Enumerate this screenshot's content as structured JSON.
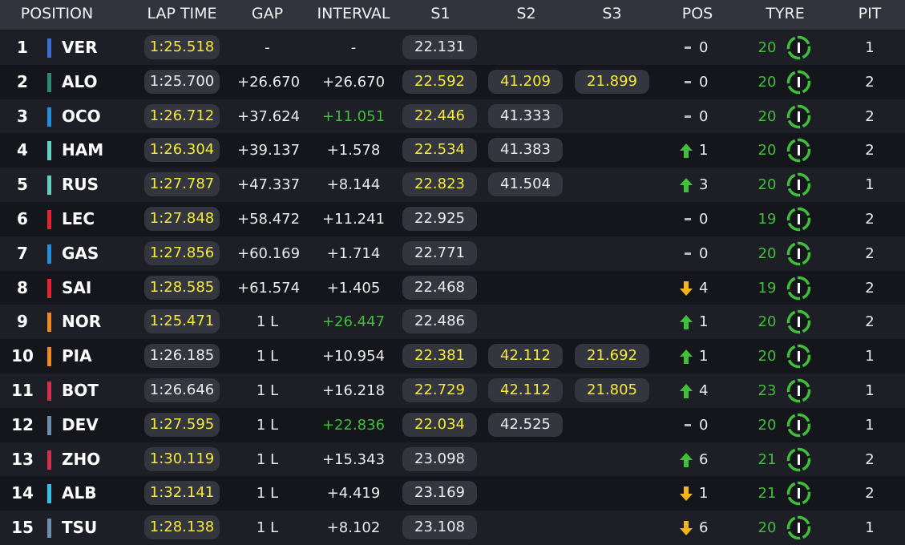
{
  "header": {
    "position": "POSITION",
    "lap_time": "LAP TIME",
    "gap": "GAP",
    "interval": "INTERVAL",
    "s1": "S1",
    "s2": "S2",
    "s3": "S3",
    "pos": "POS",
    "tyre": "TYRE",
    "pit": "PIT"
  },
  "rows": [
    {
      "pos": "1",
      "code": "VER",
      "team_color": "#3a6fd8",
      "lap": "1:25.518",
      "lap_best": true,
      "gap": "-",
      "interval": "-",
      "interval_green": false,
      "s1": "22.131",
      "s1_y": false,
      "s2": "",
      "s2_y": false,
      "s3": "",
      "s3_y": false,
      "change": "none",
      "change_val": "0",
      "laps": "20",
      "pit": "1"
    },
    {
      "pos": "2",
      "code": "ALO",
      "team_color": "#2c8b6f",
      "lap": "1:25.700",
      "lap_best": false,
      "gap": "+26.670",
      "interval": "+26.670",
      "interval_green": false,
      "s1": "22.592",
      "s1_y": true,
      "s2": "41.209",
      "s2_y": true,
      "s3": "21.899",
      "s3_y": true,
      "change": "none",
      "change_val": "0",
      "laps": "20",
      "pit": "2"
    },
    {
      "pos": "3",
      "code": "OCO",
      "team_color": "#1f8fe0",
      "lap": "1:26.712",
      "lap_best": true,
      "gap": "+37.624",
      "interval": "+11.051",
      "interval_green": true,
      "s1": "22.446",
      "s1_y": true,
      "s2": "41.333",
      "s2_y": false,
      "s3": "",
      "s3_y": false,
      "change": "none",
      "change_val": "0",
      "laps": "20",
      "pit": "2"
    },
    {
      "pos": "4",
      "code": "HAM",
      "team_color": "#5fd2c4",
      "lap": "1:26.304",
      "lap_best": true,
      "gap": "+39.137",
      "interval": "+1.578",
      "interval_green": false,
      "s1": "22.534",
      "s1_y": true,
      "s2": "41.383",
      "s2_y": false,
      "s3": "",
      "s3_y": false,
      "change": "up",
      "change_val": "1",
      "laps": "20",
      "pit": "2"
    },
    {
      "pos": "5",
      "code": "RUS",
      "team_color": "#5fd2c4",
      "lap": "1:27.787",
      "lap_best": true,
      "gap": "+47.337",
      "interval": "+8.144",
      "interval_green": false,
      "s1": "22.823",
      "s1_y": true,
      "s2": "41.504",
      "s2_y": false,
      "s3": "",
      "s3_y": false,
      "change": "up",
      "change_val": "3",
      "laps": "20",
      "pit": "1"
    },
    {
      "pos": "6",
      "code": "LEC",
      "team_color": "#e8232f",
      "lap": "1:27.848",
      "lap_best": true,
      "gap": "+58.472",
      "interval": "+11.241",
      "interval_green": false,
      "s1": "22.925",
      "s1_y": false,
      "s2": "",
      "s2_y": false,
      "s3": "",
      "s3_y": false,
      "change": "none",
      "change_val": "0",
      "laps": "19",
      "pit": "2"
    },
    {
      "pos": "7",
      "code": "GAS",
      "team_color": "#1f8fe0",
      "lap": "1:27.856",
      "lap_best": true,
      "gap": "+60.169",
      "interval": "+1.714",
      "interval_green": false,
      "s1": "22.771",
      "s1_y": false,
      "s2": "",
      "s2_y": false,
      "s3": "",
      "s3_y": false,
      "change": "none",
      "change_val": "0",
      "laps": "20",
      "pit": "2"
    },
    {
      "pos": "8",
      "code": "SAI",
      "team_color": "#e8232f",
      "lap": "1:28.585",
      "lap_best": true,
      "gap": "+61.574",
      "interval": "+1.405",
      "interval_green": false,
      "s1": "22.468",
      "s1_y": false,
      "s2": "",
      "s2_y": false,
      "s3": "",
      "s3_y": false,
      "change": "down",
      "change_val": "4",
      "laps": "19",
      "pit": "2"
    },
    {
      "pos": "9",
      "code": "NOR",
      "team_color": "#f08a1c",
      "lap": "1:25.471",
      "lap_best": true,
      "gap": "1 L",
      "interval": "+26.447",
      "interval_green": true,
      "s1": "22.486",
      "s1_y": false,
      "s2": "",
      "s2_y": false,
      "s3": "",
      "s3_y": false,
      "change": "up",
      "change_val": "1",
      "laps": "20",
      "pit": "2"
    },
    {
      "pos": "10",
      "code": "PIA",
      "team_color": "#f08a1c",
      "lap": "1:26.185",
      "lap_best": false,
      "gap": "1 L",
      "interval": "+10.954",
      "interval_green": false,
      "s1": "22.381",
      "s1_y": true,
      "s2": "42.112",
      "s2_y": true,
      "s3": "21.692",
      "s3_y": true,
      "change": "up",
      "change_val": "1",
      "laps": "20",
      "pit": "1"
    },
    {
      "pos": "11",
      "code": "BOT",
      "team_color": "#d62d4a",
      "lap": "1:26.646",
      "lap_best": false,
      "gap": "1 L",
      "interval": "+16.218",
      "interval_green": false,
      "s1": "22.729",
      "s1_y": true,
      "s2": "42.112",
      "s2_y": true,
      "s3": "21.805",
      "s3_y": true,
      "change": "up",
      "change_val": "4",
      "laps": "23",
      "pit": "1"
    },
    {
      "pos": "12",
      "code": "DEV",
      "team_color": "#6a8fb0",
      "lap": "1:27.595",
      "lap_best": true,
      "gap": "1 L",
      "interval": "+22.836",
      "interval_green": true,
      "s1": "22.034",
      "s1_y": true,
      "s2": "42.525",
      "s2_y": false,
      "s3": "",
      "s3_y": false,
      "change": "none",
      "change_val": "0",
      "laps": "20",
      "pit": "1"
    },
    {
      "pos": "13",
      "code": "ZHO",
      "team_color": "#d62d4a",
      "lap": "1:30.119",
      "lap_best": true,
      "gap": "1 L",
      "interval": "+15.343",
      "interval_green": false,
      "s1": "23.098",
      "s1_y": false,
      "s2": "",
      "s2_y": false,
      "s3": "",
      "s3_y": false,
      "change": "up",
      "change_val": "6",
      "laps": "21",
      "pit": "2"
    },
    {
      "pos": "14",
      "code": "ALB",
      "team_color": "#36c2e8",
      "lap": "1:32.141",
      "lap_best": true,
      "gap": "1 L",
      "interval": "+4.419",
      "interval_green": false,
      "s1": "23.169",
      "s1_y": false,
      "s2": "",
      "s2_y": false,
      "s3": "",
      "s3_y": false,
      "change": "down",
      "change_val": "1",
      "laps": "21",
      "pit": "2"
    },
    {
      "pos": "15",
      "code": "TSU",
      "team_color": "#6a8fb0",
      "lap": "1:28.138",
      "lap_best": true,
      "gap": "1 L",
      "interval": "+8.102",
      "interval_green": false,
      "s1": "23.108",
      "s1_y": false,
      "s2": "",
      "s2_y": false,
      "s3": "",
      "s3_y": false,
      "change": "down",
      "change_val": "6",
      "laps": "20",
      "pit": "1"
    }
  ],
  "colors": {
    "sector_purple_yellow": "#f5e93a",
    "interval_green": "#3fbf3a",
    "arrow_up": "#3fbf3a",
    "arrow_down": "#f2b51a",
    "tyre_ring": "#3fbf3a"
  },
  "icons": {
    "up": "arrow-up-icon",
    "down": "arrow-down-icon",
    "none": "no-change-dash-icon",
    "tyre": "intermediate-tyre-icon"
  }
}
